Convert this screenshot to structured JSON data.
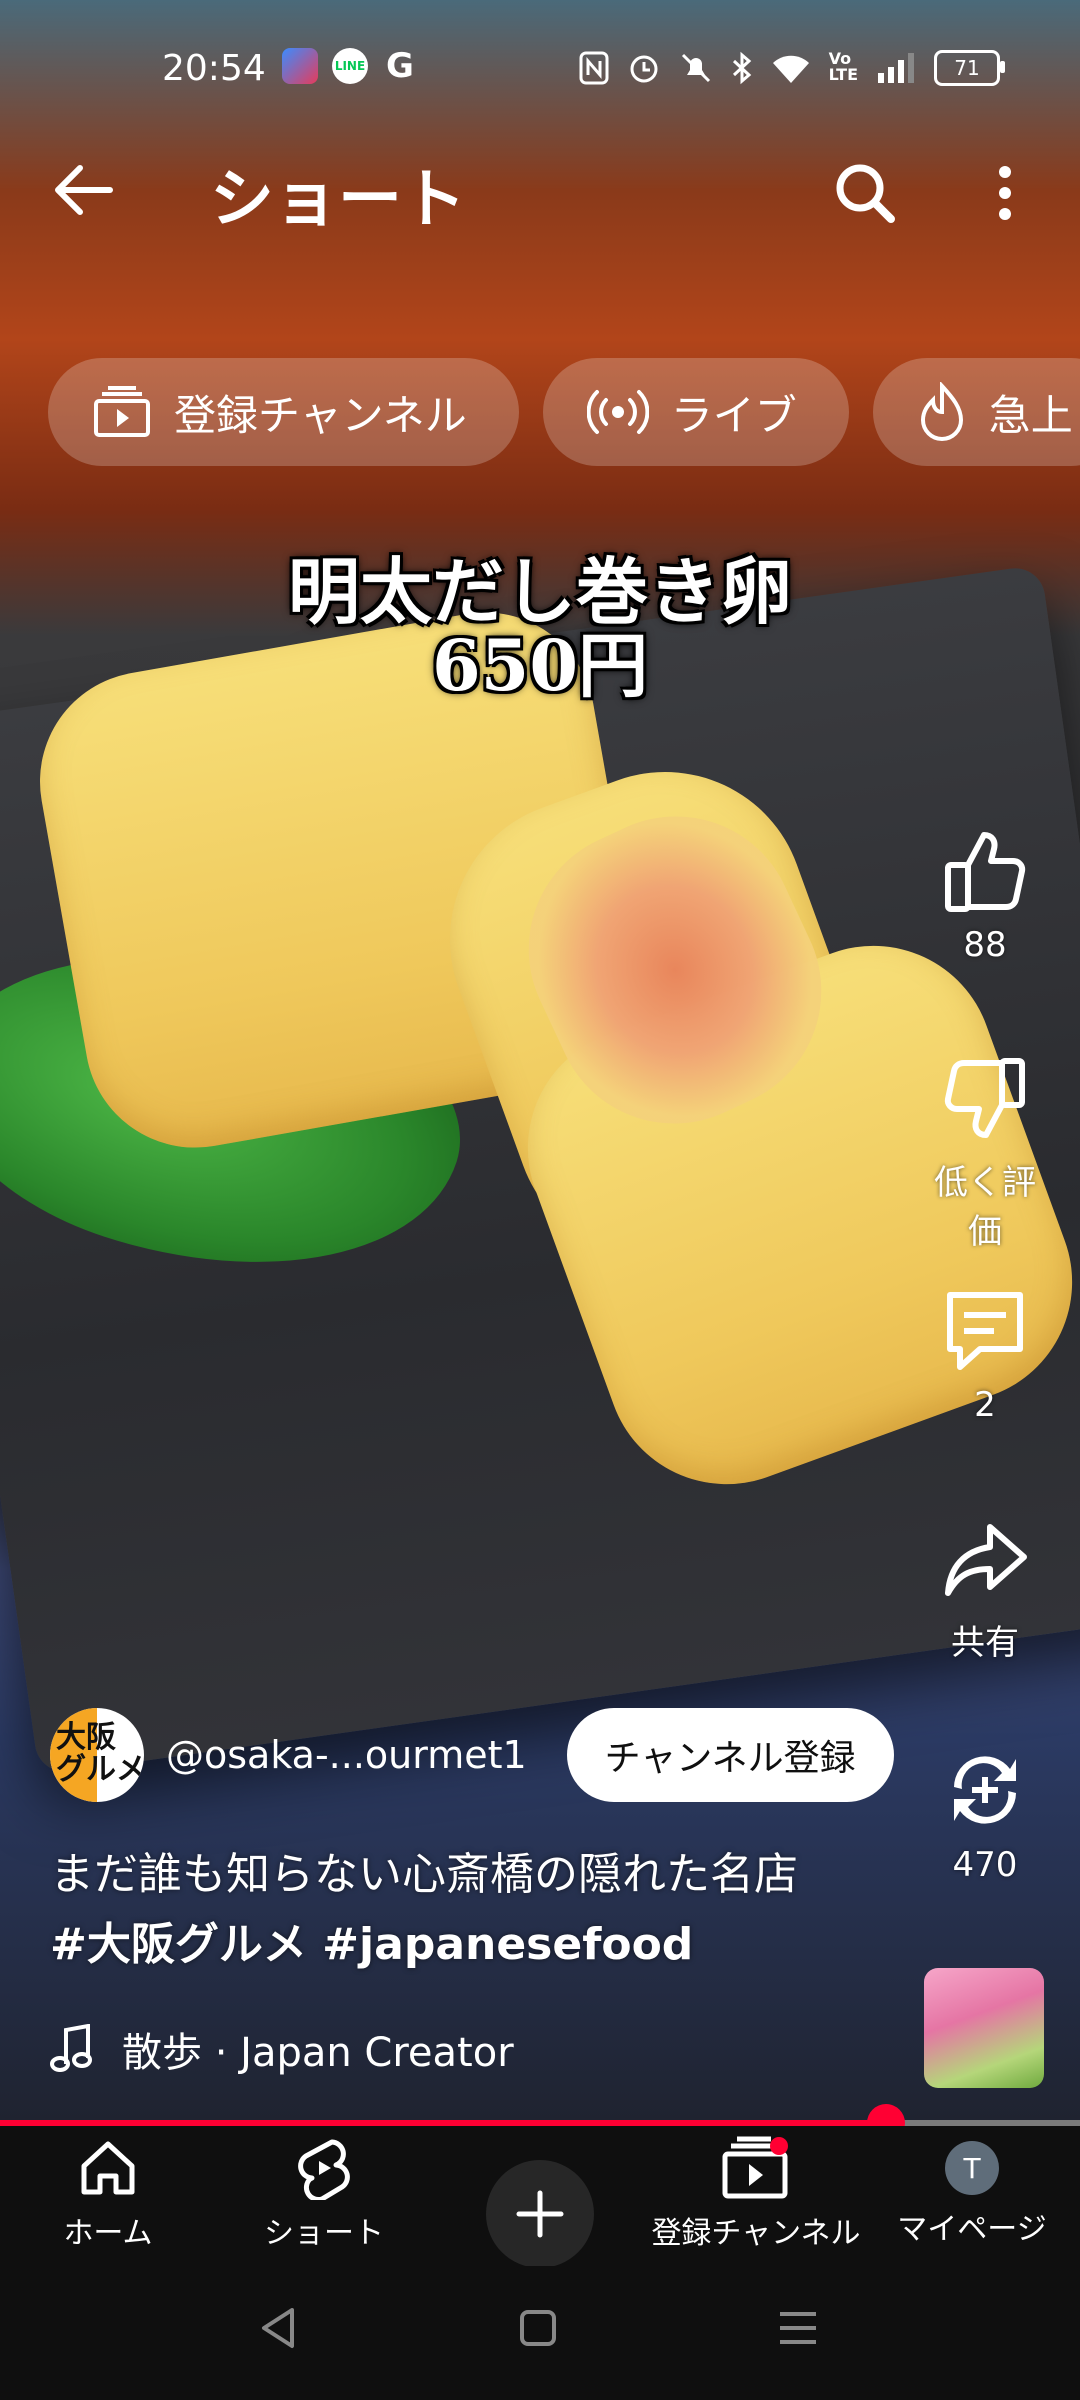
{
  "status_bar": {
    "time": "20:54",
    "battery": "71",
    "app_icons": [
      "app-icon",
      "line-icon",
      "google-icon"
    ],
    "right_icons": [
      "nfc-icon",
      "alarm-icon",
      "mute-icon",
      "bluetooth-icon",
      "wifi-icon",
      "volte-icon",
      "signal-icon"
    ]
  },
  "header": {
    "title": "ショート"
  },
  "chips": [
    {
      "label": "登録チャンネル",
      "icon": "subscriptions-icon"
    },
    {
      "label": "ライブ",
      "icon": "live-icon"
    },
    {
      "label": "急上",
      "icon": "trending-icon"
    }
  ],
  "video": {
    "caption_line1": "明太だし巻き卵",
    "caption_line2": "650円"
  },
  "actions": {
    "like_count": "88",
    "dislike_label": "低く評価",
    "comment_count": "2",
    "share_label": "共有",
    "remix_count": "470"
  },
  "channel": {
    "avatar_text": "大阪\nグルメ",
    "handle": "@osaka-...ourmet1",
    "subscribe_label": "チャンネル登録"
  },
  "description": {
    "text": "まだ誰も知らない心斎橋の隠れた名店",
    "hashtags": "#大阪グルメ #japanesefood"
  },
  "music": {
    "label": "散歩 · Japan Creator"
  },
  "progress": {
    "fraction": 0.82
  },
  "bottom_nav": {
    "home": "ホーム",
    "shorts": "ショート",
    "subscriptions": "登録チャンネル",
    "mypage": "マイページ",
    "avatar_letter": "T"
  },
  "colors": {
    "accent": "#ff0033",
    "background": "#0f0f0f"
  }
}
